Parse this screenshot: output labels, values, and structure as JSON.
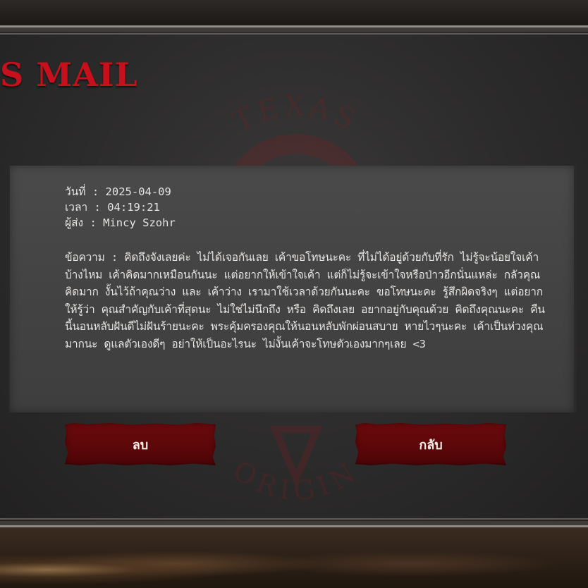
{
  "header": {
    "title": "S MAIL"
  },
  "mail": {
    "date_label": "วันที่ :",
    "date_value": "2025-04-09",
    "time_label": "เวลา :",
    "time_value": "04:19:21",
    "sender_label": "ผู้ส่ง :",
    "sender_value": "Mincy Szohr",
    "message_label": "ข้อความ :",
    "message_text": "คิดถึงจังเลยค่ะ ไม่ได้เจอกันเลย เค้าขอโทษนะคะ ที่ไม่ได้อยู่ด้วยกับที่รัก ไม่รู้จะน้อยใจเค้าบ้างไหม เค้าคิดมากเหมือนกันนะ แต่อยากให้เข้าใจเค้า แต่ก็ไม่รู้จะเข้าใจหรือป่าวอีกนั่นแหล่ะ กลัวคุณคิดมาก งั้นไว้ถ้าคุณว่าง และ เค้าว่าง เรามาใช้เวลาด้วยกันนะคะ ขอโทษนะคะ รู้สึกผิดจริงๆ แต่อยากให้รู้ว่า คุณสำคัญกับเค้าที่สุดนะ ไม่ใช่ไม่นึกถึง หรือ คิดถึงเลย อยากอยู่กับคุณด้วย คิดถึงคุณนะคะ คืนนี้นอนหลับฝันดีไม่ฝันร้ายนะคะ พระคุ้มครองคุณให้นอนหลับพักผ่อนสบาย หายไวๆนะคะ เค้าเป็นห่วงคุณมากนะ ดูแลตัวเองดีๆ อย่าให้เป็นอะไรนะ ไม่งั้นเค้าจะโทษตัวเองมากๆเลย <3"
  },
  "buttons": {
    "delete_label": "ลบ",
    "back_label": "กลับ"
  },
  "watermark": {
    "top_text": "TEXAS",
    "bottom_text": "ORIGIN"
  },
  "colors": {
    "title_red": "#c8101c",
    "button_red": "#5b0709",
    "panel_gray": "#2c2b2b"
  }
}
